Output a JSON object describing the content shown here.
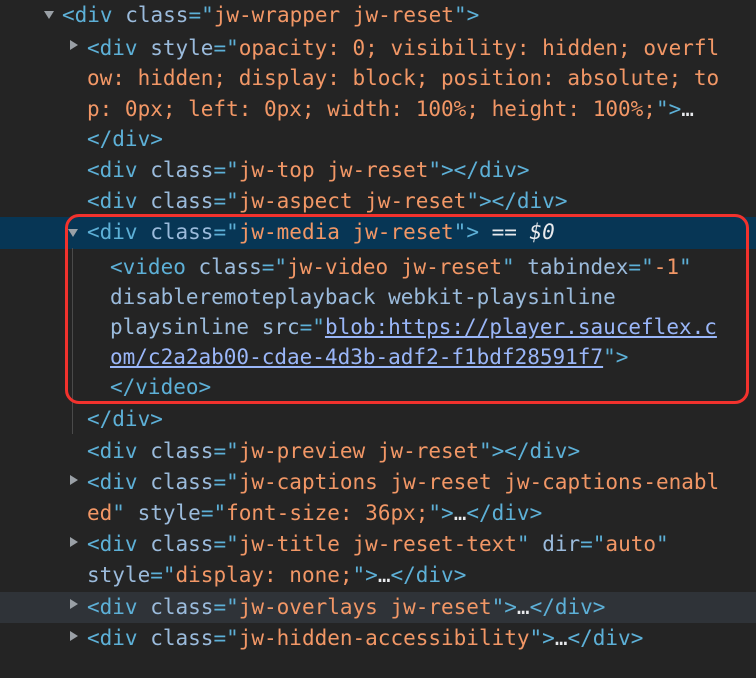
{
  "lines": [
    {
      "parts": [
        {
          "c": "t",
          "s": "<div "
        },
        {
          "c": "a",
          "s": "class"
        },
        {
          "c": "t",
          "s": "=\""
        },
        {
          "c": "v",
          "s": "jw-wrapper jw-reset"
        },
        {
          "c": "t",
          "s": "\">"
        }
      ]
    },
    {
      "parts": [
        {
          "c": "t",
          "s": "<div "
        },
        {
          "c": "a",
          "s": "style"
        },
        {
          "c": "t",
          "s": "=\""
        },
        {
          "c": "v",
          "s": "opacity: 0; visibility: hidden; overfl"
        }
      ]
    },
    {
      "parts": [
        {
          "c": "v",
          "s": "ow: hidden; display: block; position: absolute; to"
        }
      ]
    },
    {
      "parts": [
        {
          "c": "v",
          "s": "p: 0px; left: 0px; width: 100%; height: 100%;"
        },
        {
          "c": "t",
          "s": "\">"
        },
        {
          "c": "txt",
          "s": "…"
        }
      ]
    },
    {
      "parts": [
        {
          "c": "t",
          "s": "</div>"
        }
      ]
    },
    {
      "parts": [
        {
          "c": "t",
          "s": "<div "
        },
        {
          "c": "a",
          "s": "class"
        },
        {
          "c": "t",
          "s": "=\""
        },
        {
          "c": "v",
          "s": "jw-top jw-reset"
        },
        {
          "c": "t",
          "s": "\"></div>"
        }
      ]
    },
    {
      "parts": [
        {
          "c": "t",
          "s": "<div "
        },
        {
          "c": "a",
          "s": "class"
        },
        {
          "c": "t",
          "s": "=\""
        },
        {
          "c": "v",
          "s": "jw-aspect jw-reset"
        },
        {
          "c": "t",
          "s": "\"></div>"
        }
      ]
    },
    {
      "parts": [
        {
          "c": "t",
          "s": "<div "
        },
        {
          "c": "a",
          "s": "class"
        },
        {
          "c": "t",
          "s": "=\""
        },
        {
          "c": "v",
          "s": "jw-media jw-reset"
        },
        {
          "c": "t",
          "s": "\">"
        },
        {
          "c": "eq",
          "s": " == $0"
        }
      ]
    },
    {
      "parts": [
        {
          "c": "t",
          "s": "<video "
        },
        {
          "c": "a",
          "s": "class"
        },
        {
          "c": "t",
          "s": "=\""
        },
        {
          "c": "v",
          "s": "jw-video jw-reset"
        },
        {
          "c": "t",
          "s": "\" "
        },
        {
          "c": "a",
          "s": "tabindex"
        },
        {
          "c": "t",
          "s": "=\""
        },
        {
          "c": "v",
          "s": "-1"
        },
        {
          "c": "t",
          "s": "\""
        }
      ]
    },
    {
      "parts": [
        {
          "c": "a",
          "s": "disableremoteplayback webkit-playsinline"
        }
      ]
    },
    {
      "parts": [
        {
          "c": "a",
          "s": "playsinline "
        },
        {
          "c": "a",
          "s": "src"
        },
        {
          "c": "t",
          "s": "=\""
        },
        {
          "c": "link",
          "s": "blob:https://player.sauceflex.c"
        }
      ]
    },
    {
      "parts": [
        {
          "c": "link",
          "s": "om/c2a2ab00-cdae-4d3b-adf2-f1bdf28591f7"
        },
        {
          "c": "t",
          "s": "\">"
        }
      ]
    },
    {
      "parts": [
        {
          "c": "t",
          "s": "</video>"
        }
      ]
    },
    {
      "parts": [
        {
          "c": "t",
          "s": "</div>"
        }
      ]
    },
    {
      "parts": [
        {
          "c": "t",
          "s": "<div "
        },
        {
          "c": "a",
          "s": "class"
        },
        {
          "c": "t",
          "s": "=\""
        },
        {
          "c": "v",
          "s": "jw-preview jw-reset"
        },
        {
          "c": "t",
          "s": "\"></div>"
        }
      ]
    },
    {
      "parts": [
        {
          "c": "t",
          "s": "<div "
        },
        {
          "c": "a",
          "s": "class"
        },
        {
          "c": "t",
          "s": "=\""
        },
        {
          "c": "v",
          "s": "jw-captions jw-reset jw-captions-enabl"
        }
      ]
    },
    {
      "parts": [
        {
          "c": "v",
          "s": "ed"
        },
        {
          "c": "t",
          "s": "\" "
        },
        {
          "c": "a",
          "s": "style"
        },
        {
          "c": "t",
          "s": "=\""
        },
        {
          "c": "v",
          "s": "font-size: 36px;"
        },
        {
          "c": "t",
          "s": "\">"
        },
        {
          "c": "txt",
          "s": "…"
        },
        {
          "c": "t",
          "s": "</div>"
        }
      ]
    },
    {
      "parts": [
        {
          "c": "t",
          "s": "<div "
        },
        {
          "c": "a",
          "s": "class"
        },
        {
          "c": "t",
          "s": "=\""
        },
        {
          "c": "v",
          "s": "jw-title jw-reset-text"
        },
        {
          "c": "t",
          "s": "\" "
        },
        {
          "c": "a",
          "s": "dir"
        },
        {
          "c": "t",
          "s": "=\""
        },
        {
          "c": "v",
          "s": "auto"
        },
        {
          "c": "t",
          "s": "\""
        }
      ]
    },
    {
      "parts": [
        {
          "c": "a",
          "s": "style"
        },
        {
          "c": "t",
          "s": "=\""
        },
        {
          "c": "v",
          "s": "display: none;"
        },
        {
          "c": "t",
          "s": "\">"
        },
        {
          "c": "txt",
          "s": "…"
        },
        {
          "c": "t",
          "s": "</div>"
        }
      ]
    },
    {
      "parts": [
        {
          "c": "t",
          "s": "<div "
        },
        {
          "c": "a",
          "s": "class"
        },
        {
          "c": "t",
          "s": "=\""
        },
        {
          "c": "v",
          "s": "jw-overlays jw-reset"
        },
        {
          "c": "t",
          "s": "\">"
        },
        {
          "c": "txt",
          "s": "…"
        },
        {
          "c": "t",
          "s": "</div>"
        }
      ]
    },
    {
      "parts": [
        {
          "c": "t",
          "s": "<div "
        },
        {
          "c": "a",
          "s": "class"
        },
        {
          "c": "t",
          "s": "=\""
        },
        {
          "c": "v",
          "s": "jw-hidden-accessibility"
        },
        {
          "c": "t",
          "s": "\">"
        },
        {
          "c": "txt",
          "s": "…"
        },
        {
          "c": "t",
          "s": "</div>"
        }
      ]
    }
  ],
  "colors": {
    "background": "#242424",
    "tag": "#5db0d7",
    "attribute": "#9bbbdc",
    "value": "#f29766",
    "selected_row": "#073655",
    "highlight_box": "#f2322d"
  }
}
